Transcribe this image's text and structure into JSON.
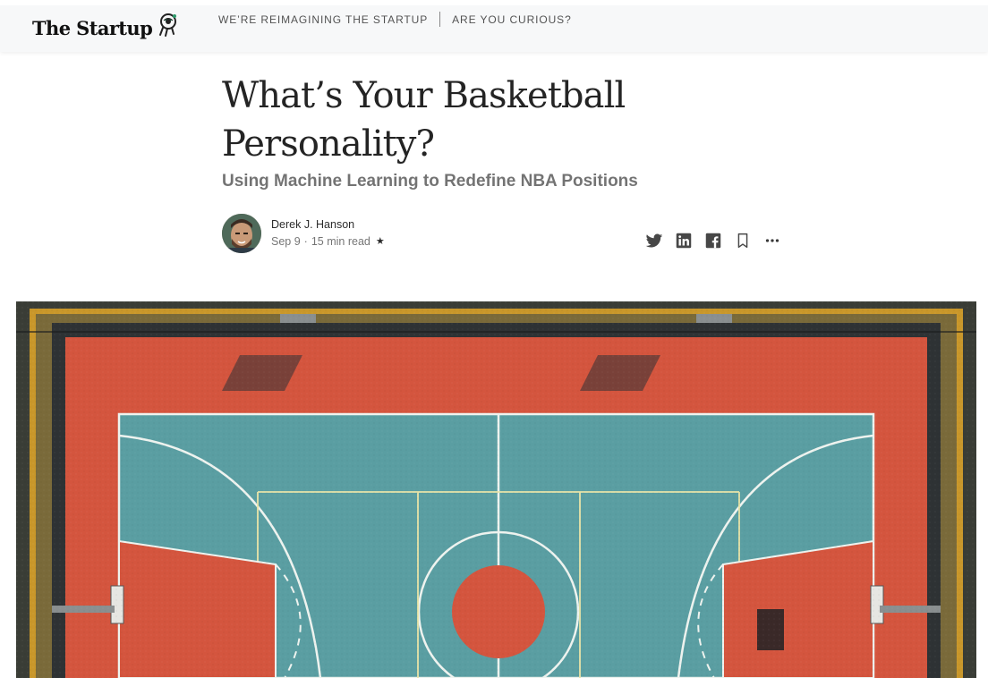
{
  "header": {
    "brand": "The Startup",
    "nav": [
      {
        "label": "WE’RE REIMAGINING THE STARTUP"
      },
      {
        "label": "ARE YOU CURIOUS?"
      }
    ]
  },
  "article": {
    "title": "What’s Your Basketball Personality?",
    "subtitle": "Using Machine Learning to Redefine NBA Positions",
    "author": "Derek J. Hanson",
    "date": "Sep 9",
    "separator": "·",
    "read_time": "15 min read",
    "member_star": "★"
  },
  "share_actions": [
    {
      "icon": "twitter-icon"
    },
    {
      "icon": "linkedin-icon"
    },
    {
      "icon": "facebook-icon"
    },
    {
      "icon": "bookmark-icon"
    },
    {
      "icon": "more-icon"
    }
  ],
  "hero_image": {
    "subject": "aerial-basketball-court"
  },
  "colors": {
    "court_teal": "#5a9ea2",
    "court_red": "#d5553f",
    "court_border": "#d4a22a",
    "header_bg": "#f7f8f9"
  }
}
